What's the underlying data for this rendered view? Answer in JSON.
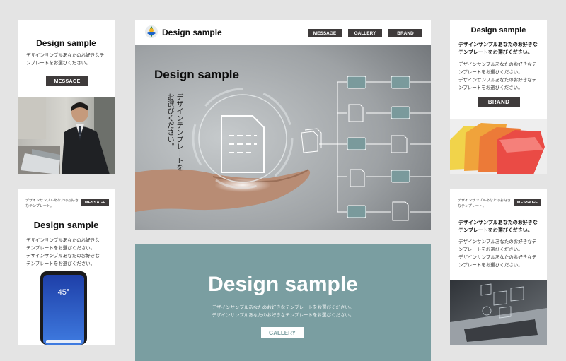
{
  "card1": {
    "title": "Design sample",
    "text_line1": "デザインサンプルあなたのお好きなテ",
    "text_line2": "ンプレートをお選びください。",
    "button": "MESSAGE"
  },
  "card2": {
    "header_text_line1": "デザインサンプルあなたのお好き",
    "header_text_line2": "なテンプレート。",
    "header_button": "MESSAGE",
    "title": "Design sample",
    "text_line1": "デザインサンプルあなたのお好きな",
    "text_line2": "テンプレートをお選びください。",
    "text_line3": "デザインサンプルあなたのお好きな",
    "text_line4": "テンプレートをお選びください。",
    "phone_time": "45°"
  },
  "main": {
    "logo_text": "Design sample",
    "nav": [
      "MESSAGE",
      "GALLERY",
      "BRAND"
    ],
    "hero_title": "Design sample",
    "vertical_line1": "デザインテンプレートを",
    "vertical_line2": "お選びください。"
  },
  "banner": {
    "title": "Design sample",
    "text_line1": "デザインサンプルあなたのお好きなテンプレートをお選びください。",
    "text_line2": "デザインサンプルあなたのお好きなテンプレートをお選びください。",
    "button": "GALLERY"
  },
  "card3": {
    "title": "Design sample",
    "bold_line1": "デザインサンプルあなたのお好きな",
    "bold_line2": "テンプレートをお選びください。",
    "text_line1": "デザインサンプルあなたのお好きなテ",
    "text_line2": "ンプレートをお選びください。",
    "text_line3": "デザインサンプルあなたのお好きなテ",
    "text_line4": "ンプレートをお選びください。",
    "button": "BRAND"
  },
  "card4": {
    "header_text_line1": "デザインサンプルあなたのお好き",
    "header_text_line2": "なテンプレート。",
    "header_button": "MESSAGE",
    "bold_line1": "デザインサンプルあなたのお好きな",
    "bold_line2": "テンプレートをお選びください。",
    "text_line1": "デザインサンプルあなたのお好きなテ",
    "text_line2": "ンプレートをお選びください。",
    "text_line3": "デザインサンプルあなたのお好きなテ",
    "text_line4": "ンプレートをお選びください。"
  },
  "colors": {
    "background": "#e4e4e4",
    "button_dark": "#3f3b3b",
    "banner_teal": "#7a9ea1",
    "folder_teal": "#7a9a9c"
  }
}
